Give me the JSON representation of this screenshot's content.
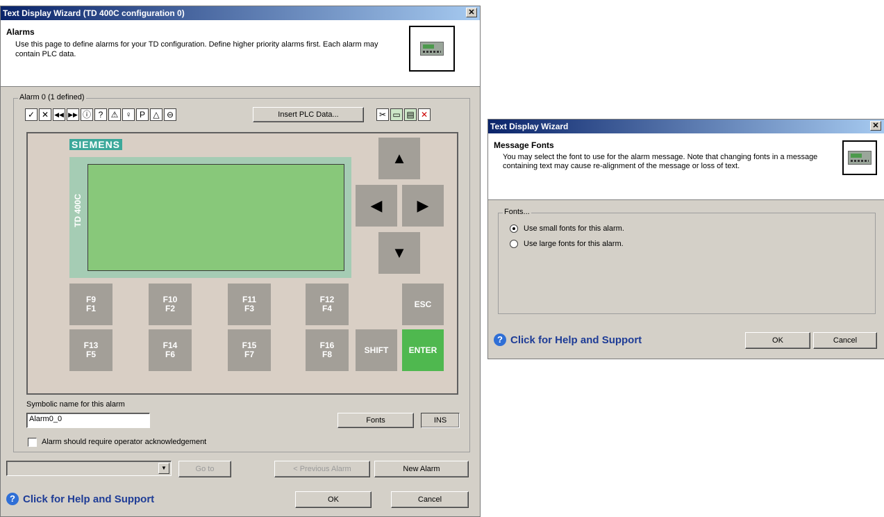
{
  "wizard": {
    "title": "Text Display Wizard (TD 400C configuration 0)",
    "close_glyph": "✕",
    "header_title": "Alarms",
    "header_desc": "Use this page to define alarms for your TD configuration. Define higher priority alarms first. Each alarm may contain PLC data.",
    "group_label": "Alarm 0 (1 defined)",
    "toolbar_left": [
      "check-icon",
      "x-box-icon",
      "rewind-icon",
      "fast-forward-icon",
      "info-icon",
      "question-icon",
      "warning-icon",
      "bulb-icon",
      "wrench-icon",
      "hazard-icon",
      "stop-icon"
    ],
    "insert_plc_label": "Insert PLC Data...",
    "toolbar_right": [
      "cut-icon",
      "copy-icon",
      "paste-icon",
      "delete-icon"
    ],
    "device": {
      "brand": "SIEMENS",
      "model": "TD 400C",
      "screen_color": "#88c87a",
      "fkeys_top": [
        {
          "top": "F9",
          "bottom": "F1"
        },
        {
          "top": "F10",
          "bottom": "F2"
        },
        {
          "top": "F11",
          "bottom": "F3"
        },
        {
          "top": "F12",
          "bottom": "F4"
        }
      ],
      "fkeys_bottom": [
        {
          "top": "F13",
          "bottom": "F5"
        },
        {
          "top": "F14",
          "bottom": "F6"
        },
        {
          "top": "F15",
          "bottom": "F7"
        },
        {
          "top": "F16",
          "bottom": "F8"
        }
      ],
      "esc": "ESC",
      "shift": "SHIFT",
      "enter": "ENTER",
      "enter_color": "#4fb84f",
      "arrows": {
        "up": "▲",
        "left": "◀",
        "right": "▶",
        "down": "▼"
      }
    },
    "symbolic_label": "Symbolic name for this alarm",
    "symbolic_value": "Alarm0_0",
    "fonts_button": "Fonts",
    "ins_button": "INS",
    "ack_label": "Alarm should require operator acknowledgement",
    "goto_label": "Go to",
    "prev_label": "< Previous Alarm",
    "new_label": "New Alarm",
    "help_text": "Click for Help and Support",
    "ok_label": "OK",
    "cancel_label": "Cancel"
  },
  "fonts_dialog": {
    "title": "Text Display Wizard",
    "close_glyph": "✕",
    "header_title": "Message Fonts",
    "header_desc": "You may select the font to use for the alarm message. Note that changing fonts in a message containing text may cause re-alignment of the message or loss of text.",
    "group_label": "Fonts...",
    "option_small": "Use small fonts for this alarm.",
    "option_large": "Use large fonts for this alarm.",
    "selected": "small",
    "help_text": "Click for Help and Support",
    "ok_label": "OK",
    "cancel_label": "Cancel"
  }
}
